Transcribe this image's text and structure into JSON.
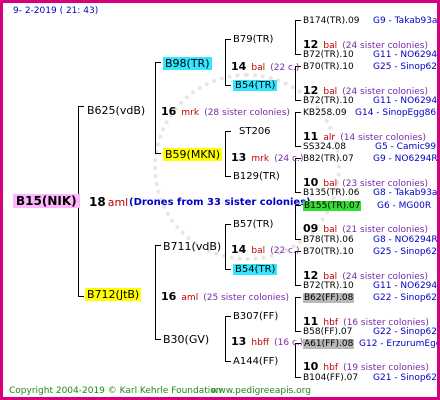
{
  "header": {
    "datetime": "9-  2-2019 (  21:  43)"
  },
  "root": {
    "name": "B15(NIK)",
    "num": "18",
    "suffix": "aml",
    "drones": "(Drones from 33 sister colonies)"
  },
  "l1": {
    "top": {
      "name": "B625(vdB)",
      "num": "16",
      "suffix": "mrk",
      "note": "(28 sister colonies)"
    },
    "bottom": {
      "name": "B712(JtB)",
      "num": "16",
      "suffix": "aml",
      "note": "(25 sister colonies)"
    }
  },
  "l2": [
    {
      "name": "B98(TR)",
      "num": "14",
      "suffix": "bal",
      "note": "(22 c.)"
    },
    {
      "name": "B59(MKN)",
      "num": "13",
      "suffix": "mrk",
      "note": "(24 c.)"
    },
    {
      "name": "B711(vdB)",
      "num": "14",
      "suffix": "bal",
      "note": "(22 c.)"
    },
    {
      "name": "B30(GV)",
      "num": "13",
      "suffix": "hbff",
      "note": "(16 c.)"
    }
  ],
  "l3": [
    {
      "name": "B79(TR)",
      "num": "12",
      "suffix": "bal",
      "note": "(24 sister colonies)"
    },
    {
      "name": "B54(TR)",
      "num": "12",
      "suffix": "bal",
      "note": "(24 sister colonies)"
    },
    {
      "name": "ST206",
      "num": "11",
      "suffix": "alr",
      "note": "(14 sister colonies)"
    },
    {
      "name": "B129(TR)",
      "num": "10",
      "suffix": "bal",
      "note": "(23 sister colonies)"
    },
    {
      "name": "B57(TR)",
      "num": "09",
      "suffix": "bal",
      "note": "(21 sister colonies)"
    },
    {
      "name": "B54(TR)",
      "num": "12",
      "suffix": "bal",
      "note": "(24 sister colonies)"
    },
    {
      "name": "B307(FF)",
      "num": "11",
      "suffix": "hbf",
      "note": "(16 sister colonies)"
    },
    {
      "name": "A144(FF)",
      "num": "10",
      "suffix": "hbf",
      "note": "(19 sister colonies)"
    }
  ],
  "l4": [
    {
      "name": "B174(TR).09",
      "breeder": "G9 - Takab93aR"
    },
    {
      "name": "B72(TR).10",
      "breeder": "G11 - NO6294R"
    },
    {
      "name": "B70(TR).10",
      "breeder": "G25 - Sinop62R"
    },
    {
      "name": "B72(TR).10",
      "breeder": "G11 - NO6294R"
    },
    {
      "name": "KB258.09",
      "breeder": "G14 - SinopEgg86R"
    },
    {
      "name": "SS324.08",
      "breeder": "G5 - Camic99R"
    },
    {
      "name": "B82(TR).07",
      "breeder": "G9 - NO6294R"
    },
    {
      "name": "B135(TR).06",
      "breeder": "G8 - Takab93aR"
    },
    {
      "name": "B155(TR).07",
      "breeder": "G6 - MG00R"
    },
    {
      "name": "B78(TR).06",
      "breeder": "G8 - NO6294R"
    },
    {
      "name": "B70(TR).10",
      "breeder": "G25 - Sinop62R"
    },
    {
      "name": "B72(TR).10",
      "breeder": "G11 - NO6294R"
    },
    {
      "name": "B62(FF).08",
      "breeder": "G22 - Sinop62R"
    },
    {
      "name": "B58(FF).07",
      "breeder": "G22 - Sinop62R"
    },
    {
      "name": "A61(FF).08",
      "breeder": "G12 - ErzurumEgg8"
    },
    {
      "name": "B104(FF).07",
      "breeder": "G21 - Sinop62R"
    }
  ],
  "footer": {
    "copyright": "Copyright 2004-2019 © Karl Kehrle Foundation",
    "url": "www.pedigreeapis.org"
  }
}
